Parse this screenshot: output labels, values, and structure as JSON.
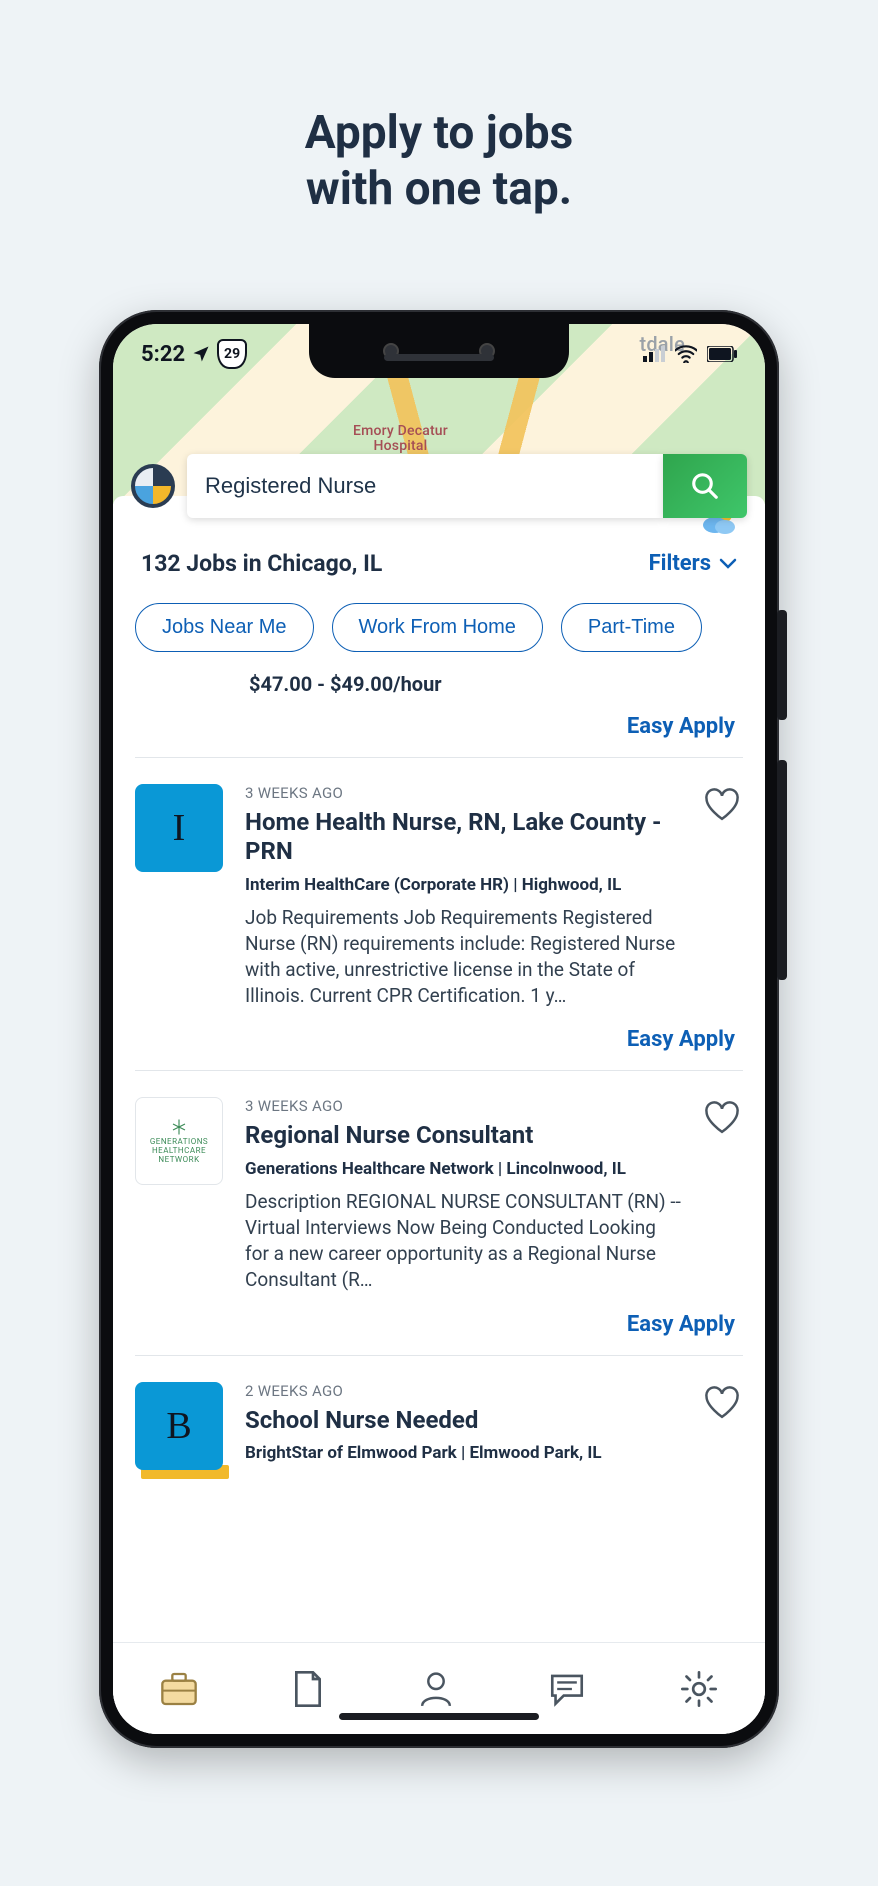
{
  "marketing": {
    "line1": "Apply to jobs",
    "line2": "with one tap."
  },
  "statusbar": {
    "time": "5:22",
    "route_shield": "29",
    "map_label_right": "tdale",
    "map_label_hospital_1": "Emory Decatur",
    "map_label_hospital_2": "Hospital"
  },
  "search": {
    "value": "Registered Nurse"
  },
  "results": {
    "title": "132 Jobs in Chicago, IL",
    "filters_label": "Filters"
  },
  "chips": [
    "Jobs Near Me",
    "Work From Home",
    "Part-Time"
  ],
  "top_pay": "$47.00 - $49.00/hour",
  "easy_apply_label": "Easy Apply",
  "jobs": [
    {
      "logo_style": "blue",
      "logo_text": "I",
      "ago": "3 WEEKS AGO",
      "title": "Home Health Nurse, RN, Lake County - PRN",
      "meta": "Interim HealthCare (Corporate HR) | Highwood, IL",
      "desc": "Job Requirements Job Requirements Registered Nurse (RN) requirements include: Registered Nurse with active, unrestrictive license in the State of Illinois. Current CPR Certification. 1 y…"
    },
    {
      "logo_style": "outline",
      "logo_text": "GENERATIONS HEALTHCARE NETWORK",
      "ago": "3 WEEKS AGO",
      "title": "Regional Nurse Consultant",
      "meta": "Generations Healthcare Network | Lincolnwood, IL",
      "desc": "Description REGIONAL NURSE CONSULTANT (RN) -- Virtual Interviews Now Being Conducted Looking for a new career opportunity as a Regional Nurse Consultant (R…"
    },
    {
      "logo_style": "blue",
      "logo_text": "B",
      "ago": "2 WEEKS AGO",
      "title": "School Nurse Needed",
      "meta": "BrightStar of Elmwood Park | Elmwood Park, IL",
      "desc": ""
    }
  ]
}
